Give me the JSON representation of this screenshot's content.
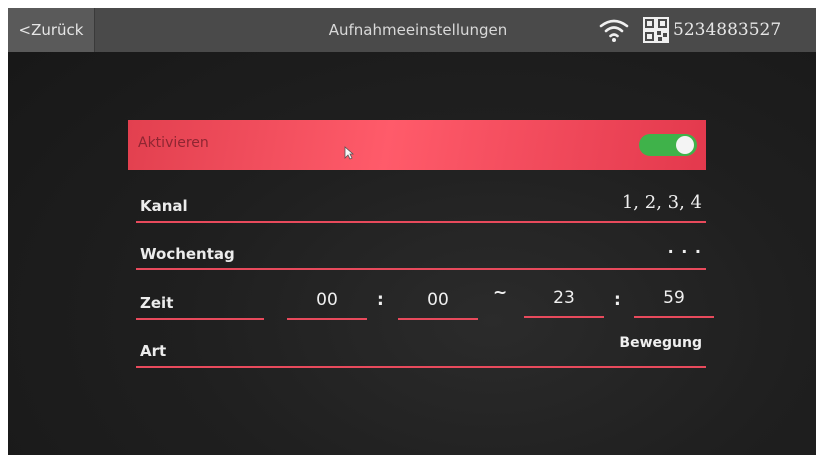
{
  "header": {
    "back_label": "<Zurück",
    "title": "Aufnahmeeinstellungen",
    "device_id": "5234883527"
  },
  "settings": {
    "enable": {
      "label": "Aktivieren",
      "enabled": true
    },
    "channel": {
      "label": "Kanal",
      "value": "1, 2, 3, 4"
    },
    "weekday": {
      "label": "Wochentag",
      "value": "· · ·"
    },
    "time": {
      "label": "Zeit",
      "start_hour": "00",
      "start_minute": "00",
      "range_sep": "~",
      "end_hour": "23",
      "end_minute": "59",
      "colon": ":"
    },
    "type": {
      "label": "Art",
      "value": "Bewegung"
    }
  },
  "colors": {
    "accent": "#e84a5c",
    "toggle_on": "#3fb24a",
    "topbar": "#4a4a4a"
  },
  "icons": [
    "wifi-icon",
    "qr-code-icon",
    "mouse-cursor-icon"
  ]
}
